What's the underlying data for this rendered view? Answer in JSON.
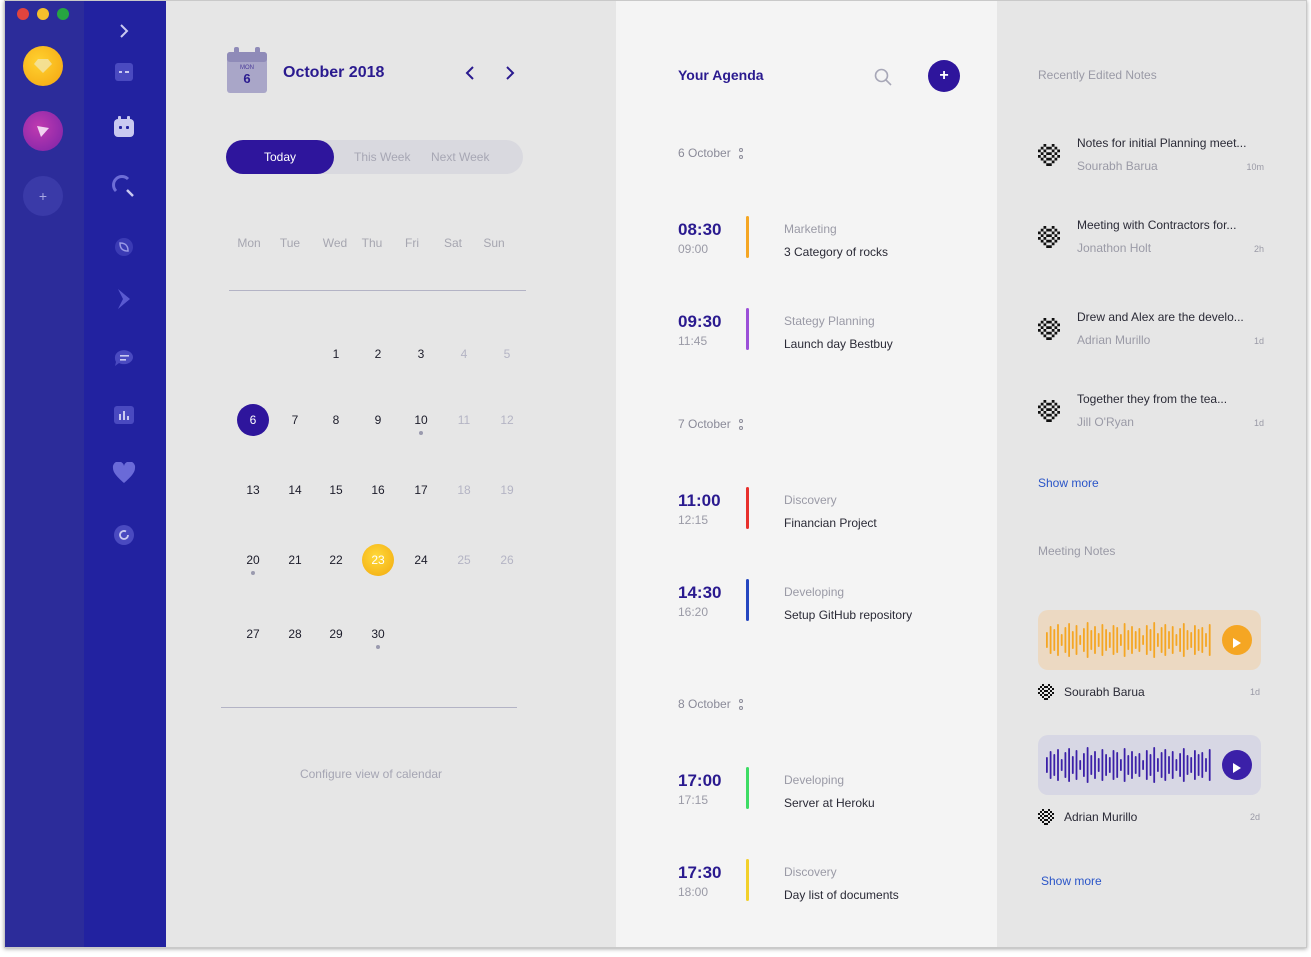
{
  "colors": {
    "rail": "#2c2c9a",
    "nav": "#2222a0",
    "accent": "#2e159c",
    "today": "#f2a90e",
    "link": "#2a55c8"
  },
  "rail": {
    "apps": [
      "sketch-app-icon",
      "prototype-app-icon"
    ],
    "add_label": "+"
  },
  "nav": {
    "items": [
      "toggle-icon",
      "dashboard-icon",
      "calendar-icon",
      "search-icon",
      "leaf-icon",
      "bolt-icon",
      "chat-icon",
      "chart-icon",
      "heart-icon",
      "refresh-icon"
    ]
  },
  "calendar": {
    "icon_weekday": "MON",
    "icon_day": "6",
    "month_title": "October 2018",
    "ranges": [
      "Today",
      "This Week",
      "Next Week"
    ],
    "weekdays": [
      "Mon",
      "Tue",
      "Wed",
      "Thu",
      "Fri",
      "Sat",
      "Sun"
    ],
    "selected_day": "6",
    "today_day": "23",
    "days_with_events": [
      "10",
      "20",
      "30"
    ],
    "weeks": [
      [
        "",
        "",
        "1",
        "2",
        "3",
        "4",
        "5"
      ],
      [
        "6",
        "7",
        "8",
        "9",
        "10",
        "11",
        "12"
      ],
      [
        "13",
        "14",
        "15",
        "16",
        "17",
        "18",
        "19"
      ],
      [
        "20",
        "21",
        "22",
        "23",
        "24",
        "25",
        "26"
      ],
      [
        "27",
        "28",
        "29",
        "30",
        "",
        "",
        ""
      ]
    ],
    "config_link": "Configure view of calendar"
  },
  "agenda": {
    "title": "Your Agenda",
    "days": [
      {
        "date": "6 October",
        "events": [
          {
            "start": "08:30",
            "end": "09:00",
            "category": "Marketing",
            "name": "3 Category of rocks",
            "color": "#f5a623"
          },
          {
            "start": "09:30",
            "end": "11:45",
            "category": "Stategy Planning",
            "name": "Launch day Bestbuy",
            "color": "#9b4fd8"
          }
        ]
      },
      {
        "date": "7 October",
        "events": [
          {
            "start": "11:00",
            "end": "12:15",
            "category": "Discovery",
            "name": "Financian Project",
            "color": "#e8302c"
          },
          {
            "start": "14:30",
            "end": "16:20",
            "category": "Developing",
            "name": "Setup GitHub repository",
            "color": "#2446c0"
          }
        ]
      },
      {
        "date": "8 October",
        "events": [
          {
            "start": "17:00",
            "end": "17:15",
            "category": "Developing",
            "name": "Server at Heroku",
            "color": "#3ddc64"
          },
          {
            "start": "17:30",
            "end": "18:00",
            "category": "Discovery",
            "name": "Day list of documents",
            "color": "#f2d02a"
          }
        ]
      }
    ]
  },
  "notes": {
    "recent_title": "Recently Edited Notes",
    "recent": [
      {
        "title": "Notes for initial Planning meet...",
        "author": "Sourabh Barua",
        "time": "10m"
      },
      {
        "title": "Meeting with Contractors for...",
        "author": "Jonathon Holt",
        "time": "2h"
      },
      {
        "title": "Drew and Alex are the develo...",
        "author": "Adrian Murillo",
        "time": "1d"
      },
      {
        "title": "Together they from the tea...",
        "author": "Jill O'Ryan",
        "time": "1d"
      }
    ],
    "show_more_1": "Show more",
    "meeting_title": "Meeting Notes",
    "voice": [
      {
        "author": "Sourabh Barua",
        "time": "1d",
        "color": "#f5a623",
        "bg": "#ecd9c2"
      },
      {
        "author": "Adrian Murillo",
        "time": "2d",
        "color": "#3b20a8",
        "bg": "#d7d7e4"
      }
    ],
    "show_more_2": "Show more"
  }
}
